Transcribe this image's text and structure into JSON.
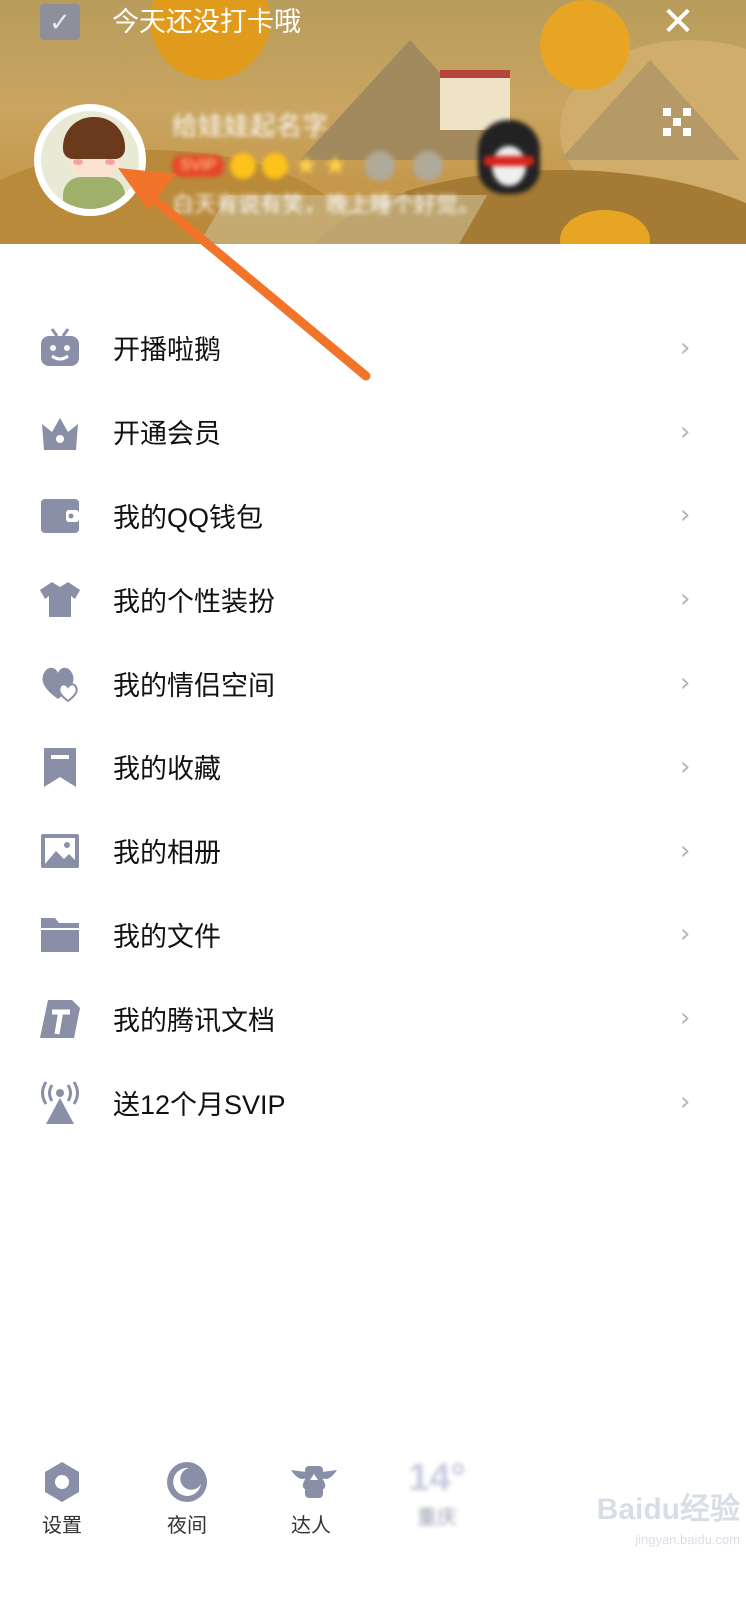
{
  "header": {
    "checkin_text": "今天还没打卡哦",
    "nickname": "给娃娃起名字",
    "vip_badge": "SVIP",
    "signature": "白天有说有笑，晚上睡个好觉。"
  },
  "menu": {
    "items": [
      {
        "label": "开播啦鹅",
        "icon": "tv-robot-icon"
      },
      {
        "label": "开通会员",
        "icon": "crown-icon"
      },
      {
        "label": "我的QQ钱包",
        "icon": "wallet-icon"
      },
      {
        "label": "我的个性装扮",
        "icon": "shirt-icon"
      },
      {
        "label": "我的情侣空间",
        "icon": "couple-hearts-icon"
      },
      {
        "label": "我的收藏",
        "icon": "bookmark-icon"
      },
      {
        "label": "我的相册",
        "icon": "photo-icon"
      },
      {
        "label": "我的文件",
        "icon": "folder-icon"
      },
      {
        "label": "我的腾讯文档",
        "icon": "tencent-docs-icon"
      },
      {
        "label": "送12个月SVIP",
        "icon": "broadcast-icon"
      }
    ],
    "chevron": "›"
  },
  "bottom_bar": {
    "settings_label": "设置",
    "night_label": "夜间",
    "daren_label": "达人",
    "weather_temp": "14°",
    "weather_city": "重庆"
  },
  "watermark": {
    "brand": "Baidu经验",
    "url": "jingyan.baidu.com"
  },
  "colors": {
    "icon_gray": "#8a8fa8",
    "accent_arrow": "#f2742a",
    "text": "#111111"
  }
}
